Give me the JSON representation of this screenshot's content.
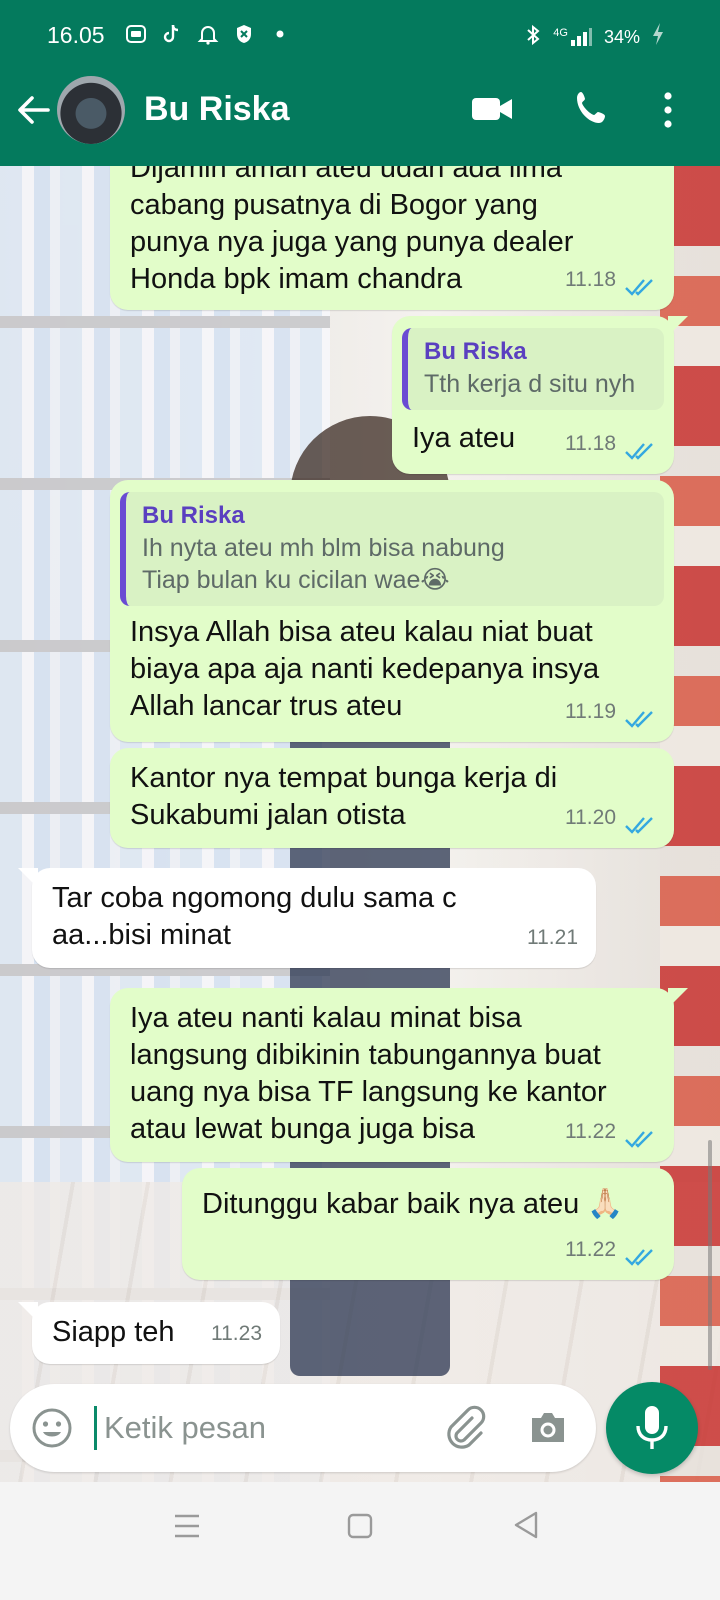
{
  "status_bar": {
    "time": "16.05",
    "network": "4G",
    "battery": "34%",
    "icons_left": [
      "browser-icon",
      "tiktok-icon",
      "bell-icon",
      "shield-icon",
      "dot-icon"
    ],
    "icons_right": [
      "bluetooth-icon",
      "signal-icon",
      "battery-charging-icon"
    ]
  },
  "header": {
    "contact_name": "Bu Riska",
    "actions": [
      "video-call-icon",
      "voice-call-icon",
      "more-options-icon"
    ],
    "accent_color": "#047a5d"
  },
  "messages": [
    {
      "direction": "out",
      "lines": [
        "Dijamin aman ateu udah ada lima",
        "cabang pusatnya di Bogor yang",
        "punya nya juga yang punya dealer",
        "Honda bpk imam chandra"
      ],
      "time": "11.18",
      "status": "read"
    },
    {
      "direction": "out",
      "quote": {
        "name": "Bu Riska",
        "lines": [
          "Tth kerja d situ nyh"
        ]
      },
      "lines": [
        "Iya ateu"
      ],
      "time": "11.18",
      "status": "read"
    },
    {
      "direction": "out",
      "quote": {
        "name": "Bu Riska",
        "lines": [
          "Ih nyta ateu mh blm bisa nabung",
          "Tiap bulan ku cicilan wae😭"
        ]
      },
      "lines": [
        "Insya Allah bisa ateu kalau niat buat",
        "biaya apa aja nanti kedepanya insya",
        "Allah lancar trus ateu"
      ],
      "time": "11.19",
      "status": "read"
    },
    {
      "direction": "out",
      "lines": [
        "Kantor nya tempat bunga kerja di",
        "Sukabumi jalan otista"
      ],
      "time": "11.20",
      "status": "read"
    },
    {
      "direction": "in",
      "lines": [
        "Tar coba ngomong dulu sama c",
        "aa...bisi minat"
      ],
      "time": "11.21"
    },
    {
      "direction": "out",
      "lines": [
        "Iya ateu nanti kalau minat bisa",
        "langsung dibikinin tabungannya buat",
        "uang nya bisa TF langsung ke kantor",
        "atau lewat bunga juga bisa"
      ],
      "time": "11.22",
      "status": "read"
    },
    {
      "direction": "out",
      "lines": [
        "Ditunggu kabar baik nya ateu 🙏🏻"
      ],
      "time": "11.22",
      "status": "read"
    },
    {
      "direction": "in",
      "lines": [
        "Siapp teh"
      ],
      "time": "11.23"
    }
  ],
  "composer": {
    "placeholder": "Ketik pesan",
    "icons": [
      "emoji-icon",
      "attach-icon",
      "camera-icon",
      "mic-icon"
    ]
  },
  "navbar": {
    "icons": [
      "recent-apps-icon",
      "home-icon",
      "back-icon"
    ]
  },
  "colors": {
    "outgoing_bubble": "#e2fdc9",
    "incoming_bubble": "#ffffff",
    "tick_read": "#34a8e0",
    "quote_name": "#5a3fc0"
  }
}
